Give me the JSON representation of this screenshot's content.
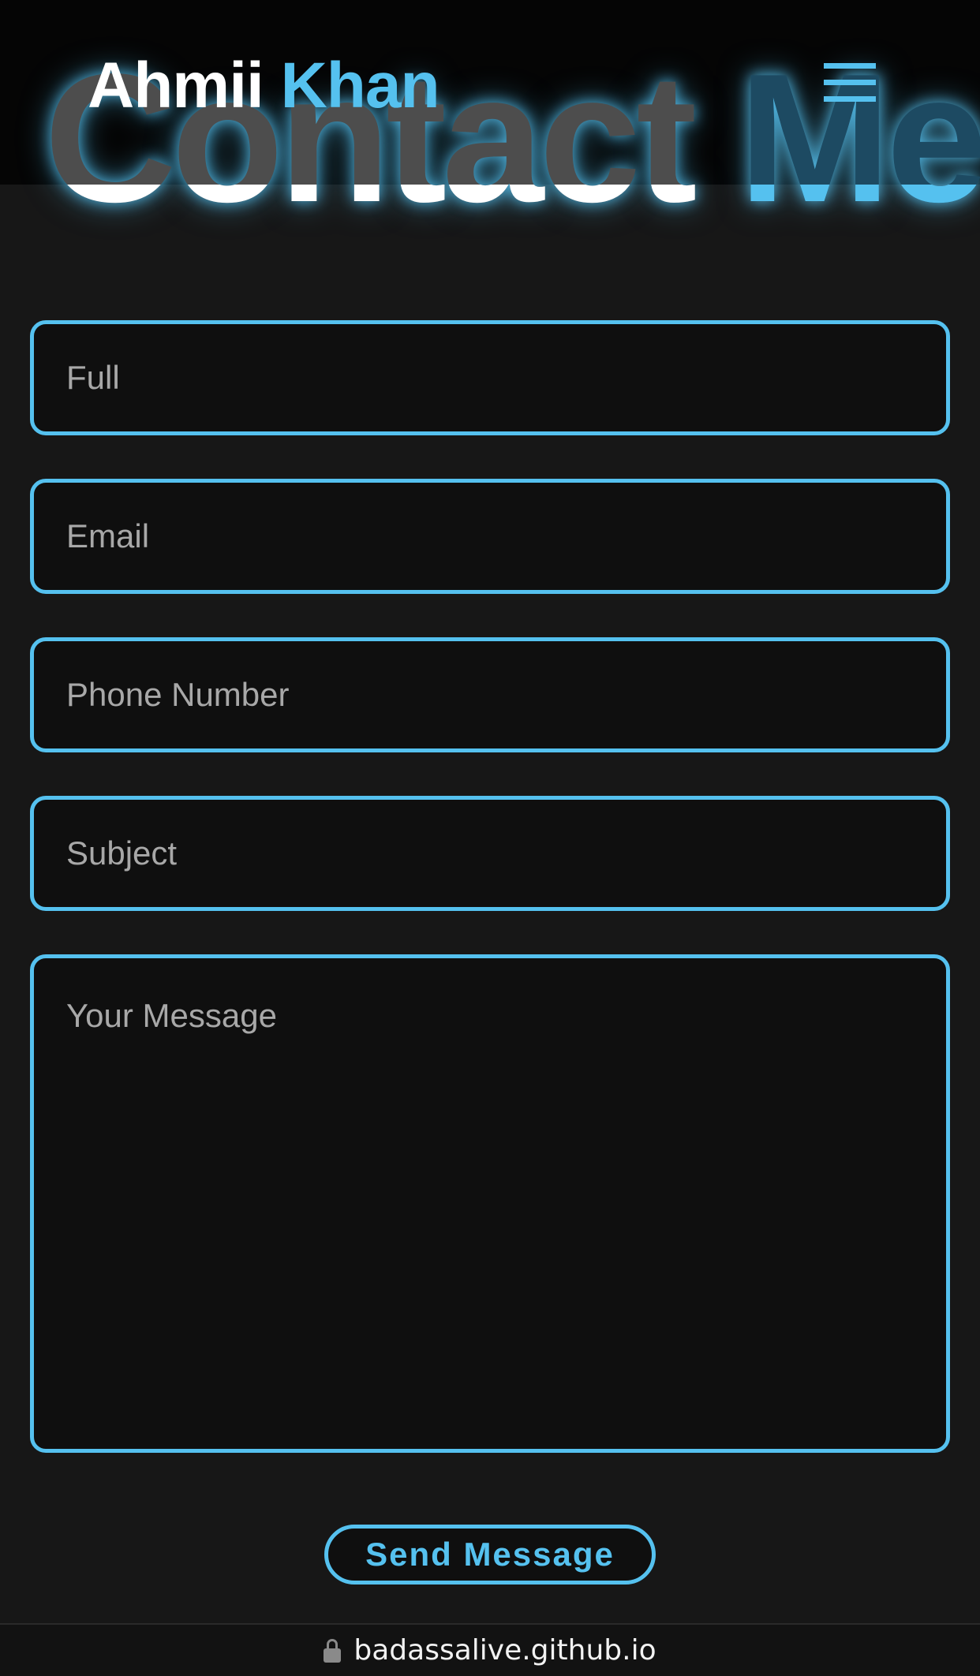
{
  "header": {
    "brand_first": "Ahmii",
    "brand_second": "Khan",
    "menu_icon": "hamburger-menu-icon"
  },
  "hero": {
    "title_word1": "Contact",
    "title_word2": "Me"
  },
  "form": {
    "name_placeholder": "Full",
    "email_placeholder": "Email",
    "phone_placeholder": "Phone Number",
    "subject_placeholder": "Subject",
    "message_placeholder": "Your Message",
    "submit_label": "Send Message"
  },
  "browser": {
    "url": "badassalive.github.io",
    "lock_icon": "lock-icon"
  },
  "colors": {
    "accent": "#55c1ef",
    "background": "#171717",
    "header_bg": "#050505",
    "field_bg": "#0f0f0f",
    "placeholder_text": "#a8a8a8"
  }
}
